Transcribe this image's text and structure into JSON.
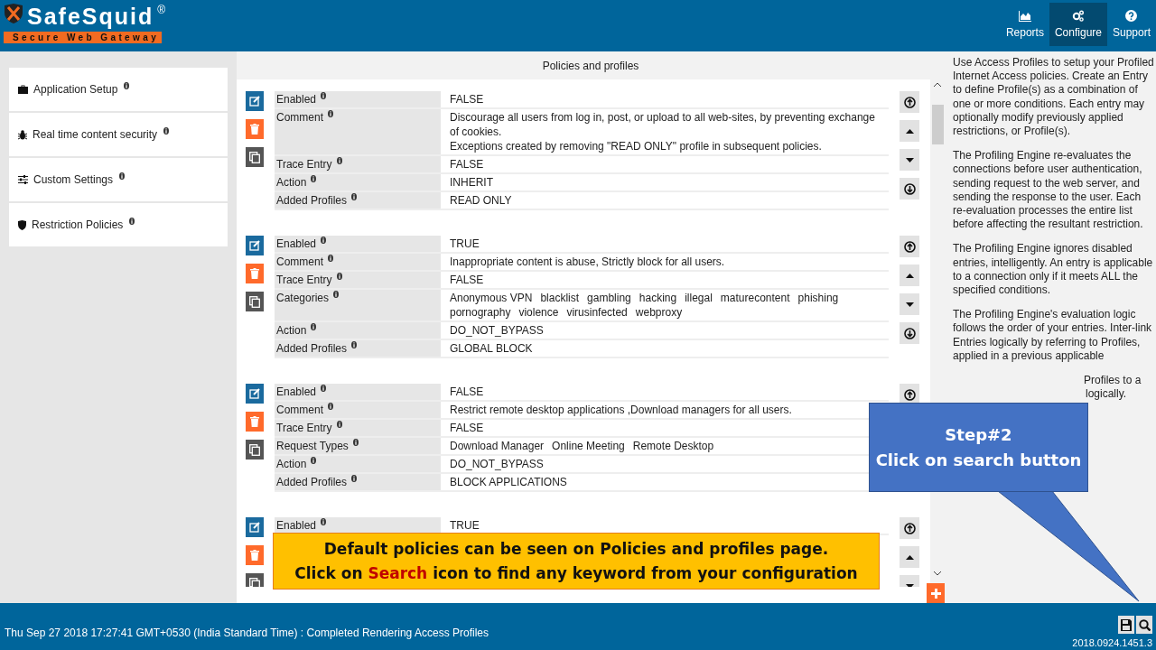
{
  "header": {
    "logo": {
      "name": "SafeSquid",
      "mark": "®",
      "tagline": "Secure Web Gateway"
    },
    "nav": [
      {
        "label": "Reports",
        "selected": false
      },
      {
        "label": "Configure",
        "selected": true
      },
      {
        "label": "Support",
        "selected": false
      }
    ]
  },
  "sidebar": {
    "items": [
      {
        "label": "Application Setup"
      },
      {
        "label": "Real time content security"
      },
      {
        "label": "Custom Settings"
      },
      {
        "label": "Restriction Policies"
      }
    ]
  },
  "main": {
    "title": "Policies and profiles",
    "entries": [
      {
        "fields": [
          {
            "label": "Enabled",
            "value": "FALSE"
          },
          {
            "label": "Comment",
            "value": "Discourage all users from log in, post, or upload to all web-sites, by preventing exchange of cookies.\nExceptions created by removing \"READ ONLY\" profile in subsequent policies."
          },
          {
            "label": "Trace Entry",
            "value": "FALSE"
          },
          {
            "label": "Action",
            "value": "INHERIT"
          },
          {
            "label": "Added Profiles",
            "value": "READ ONLY"
          }
        ],
        "move_buttons": [
          {
            "kind": "top"
          },
          {
            "kind": "up"
          },
          {
            "kind": "down"
          },
          {
            "kind": "bottom"
          }
        ]
      },
      {
        "fields": [
          {
            "label": "Enabled",
            "value": "TRUE"
          },
          {
            "label": "Comment",
            "value": "Inappropriate content is abuse, Strictly block for all users."
          },
          {
            "label": "Trace Entry",
            "value": "FALSE"
          },
          {
            "label": "Categories",
            "values": [
              "Anonymous VPN",
              "blacklist",
              "gambling",
              "hacking",
              "illegal",
              "maturecontent",
              "phishing",
              "pornography",
              "violence",
              "virusinfected",
              "webproxy"
            ]
          },
          {
            "label": "Action",
            "value": "DO_NOT_BYPASS"
          },
          {
            "label": "Added Profiles",
            "value": "GLOBAL BLOCK"
          }
        ],
        "move_buttons": [
          {
            "kind": "top"
          },
          {
            "kind": "up"
          },
          {
            "kind": "down"
          },
          {
            "kind": "bottom"
          }
        ]
      },
      {
        "fields": [
          {
            "label": "Enabled",
            "value": "FALSE"
          },
          {
            "label": "Comment",
            "value": "Restrict remote desktop applications ,Download managers for all users."
          },
          {
            "label": "Trace Entry",
            "value": "FALSE"
          },
          {
            "label": "Request Types",
            "values": [
              "Download Manager",
              "Online Meeting",
              "Remote Desktop"
            ]
          },
          {
            "label": "Action",
            "value": "DO_NOT_BYPASS"
          },
          {
            "label": "Added Profiles",
            "value": "BLOCK APPLICATIONS"
          }
        ],
        "move_buttons": [
          {
            "kind": "top"
          }
        ]
      },
      {
        "fields": [
          {
            "label": "Enabled",
            "value": "TRUE"
          }
        ],
        "move_buttons": [
          {
            "kind": "top"
          },
          {
            "kind": "up"
          },
          {
            "kind": "down"
          }
        ]
      }
    ]
  },
  "help": {
    "paragraphs": [
      "Use Access Profiles to setup your Profiled Internet Access policies. Create an Entry to define Profile(s) as a combination of one or more conditions. Each entry may optionally modify previously applied restrictions, or Profile(s).",
      "The Profiling Engine re-evaluates the connections before user authentication, sending request to the web server, and sending the response to the user. Each re-evaluation processes the entire list before affecting the resultant restriction.",
      "The Profiling Engine ignores disabled entries, intelligently. An entry is applicable to a connection only if it meets ALL the specified conditions.",
      "The Profiling Engine's evaluation logic follows the order of your entries. Inter-link Entries logically by referring to Profiles, applied in a previous applicable"
    ],
    "fragments": [
      "Profiles to a",
      "logically."
    ]
  },
  "banner": {
    "line_1": "Default policies can be seen on Policies and profiles page.",
    "line_2_start": "Click on ",
    "line_2_highlight": "Search",
    "line_2_end": " icon to find any keyword from your configuration"
  },
  "callout": {
    "title": "Step#2",
    "text": "Click on search button"
  },
  "status_bar": {
    "message": "Thu Sep 27 2018 17:27:41 GMT+0530 (India Standard Time) : Completed Rendering Access Profiles",
    "version": "2018.0924.1451.3"
  }
}
